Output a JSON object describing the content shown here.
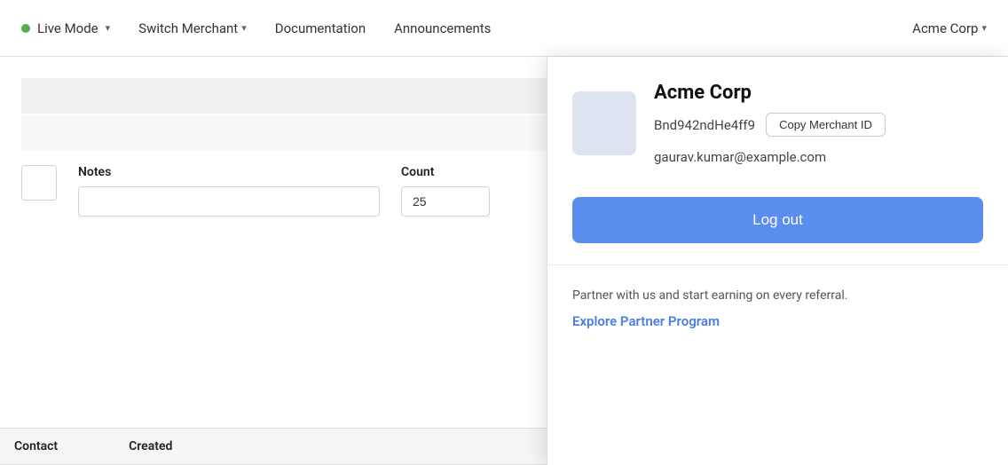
{
  "navbar": {
    "live_mode_label": "Live Mode",
    "switch_merchant_label": "Switch Merchant",
    "documentation_label": "Documentation",
    "announcements_label": "Announcements",
    "merchant_name_label": "Acme Corp"
  },
  "form": {
    "notes_label": "Notes",
    "notes_placeholder": "",
    "notes_value": "",
    "count_label": "Count",
    "count_value": "25"
  },
  "table": {
    "col_contact": "Contact",
    "col_created": "Created"
  },
  "merchant_dropdown": {
    "name": "Acme Corp",
    "merchant_id": "Bnd942ndHe4ff9",
    "copy_button_label": "Copy Merchant ID",
    "email": "gaurav.kumar@example.com",
    "logout_label": "Log out",
    "partner_text": "Partner with us and start earning on every referral.",
    "partner_link_label": "Explore Partner Program"
  },
  "colors": {
    "live_dot": "#4caf50",
    "logout_bg": "#5b8def",
    "partner_link": "#4a7de8",
    "avatar_bg": "#dde3f0"
  }
}
